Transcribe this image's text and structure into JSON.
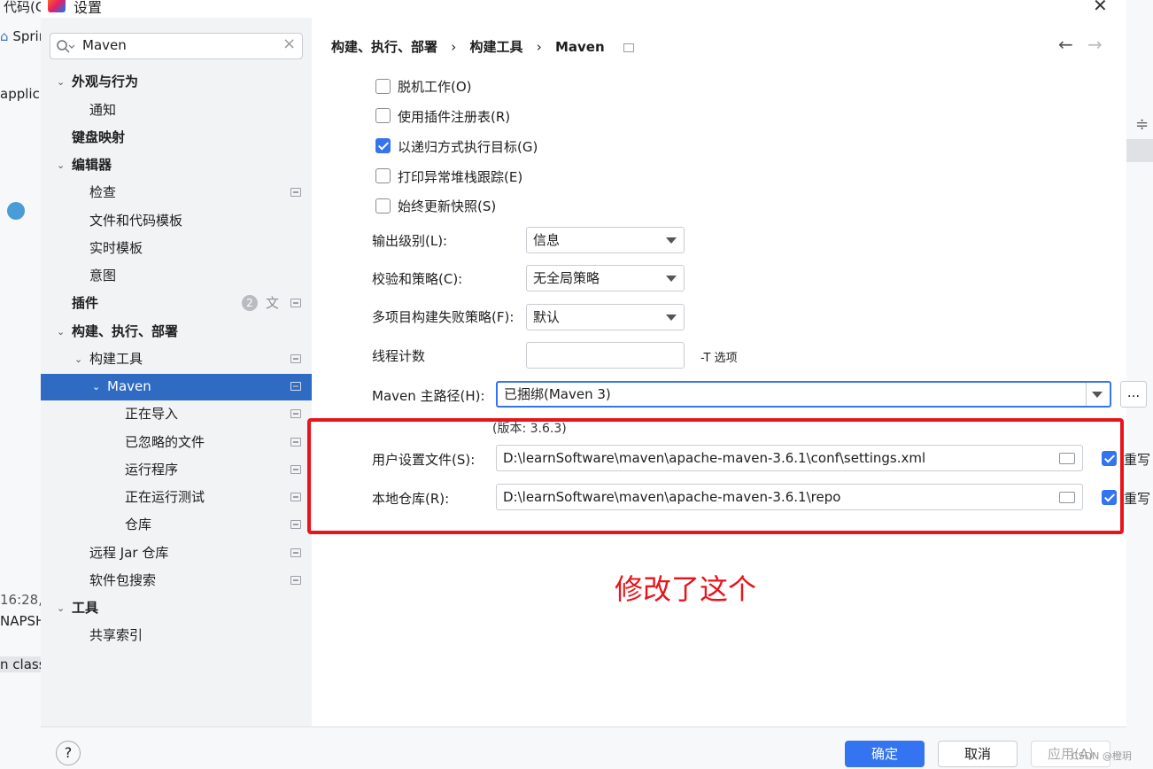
{
  "background": {
    "texts": [
      "代码(C",
      "Sprin",
      "applic",
      "16:28,",
      "NAPSH",
      "n class"
    ]
  },
  "dialog": {
    "title": "设置",
    "close_glyph": "✕",
    "search": {
      "value": "Maven",
      "clear_glyph": "×"
    },
    "tree": [
      {
        "label": "外观与行为"
      },
      {
        "label": "通知"
      },
      {
        "label": "键盘映射"
      },
      {
        "label": "编辑器"
      },
      {
        "label": "检查"
      },
      {
        "label": "文件和代码模板"
      },
      {
        "label": "实时模板"
      },
      {
        "label": "意图"
      },
      {
        "label": "插件",
        "badge": "2"
      },
      {
        "label": "构建、执行、部署"
      },
      {
        "label": "构建工具"
      },
      {
        "label": "Maven"
      },
      {
        "label": "正在导入"
      },
      {
        "label": "已忽略的文件"
      },
      {
        "label": "运行程序"
      },
      {
        "label": "正在运行测试"
      },
      {
        "label": "仓库"
      },
      {
        "label": "远程 Jar 仓库"
      },
      {
        "label": "软件包搜索"
      },
      {
        "label": "工具"
      },
      {
        "label": "共享索引"
      }
    ],
    "breadcrumb": [
      "构建、执行、部署",
      "构建工具",
      "Maven"
    ],
    "breadcrumb_sep": "›",
    "nav": {
      "back": "←",
      "forward": "→"
    },
    "checkboxes": [
      {
        "label": "脱机工作(O)",
        "checked": false
      },
      {
        "label": "使用插件注册表(R)",
        "checked": false
      },
      {
        "label": "以递归方式执行目标(G)",
        "checked": true
      },
      {
        "label": "打印异常堆栈跟踪(E)",
        "checked": false
      },
      {
        "label": "始终更新快照(S)",
        "checked": false
      }
    ],
    "output_level": {
      "label": "输出级别(L):",
      "value": "信息"
    },
    "checksum_policy": {
      "label": "校验和策略(C):",
      "value": "无全局策略"
    },
    "fail_policy": {
      "label": "多项目构建失败策略(F):",
      "value": "默认"
    },
    "thread_count": {
      "label": "线程计数",
      "value": "",
      "hint": "-T 选项"
    },
    "maven_home": {
      "label": "Maven 主路径(H):",
      "value": "已捆绑(Maven 3)",
      "browse": "...",
      "version": "(版本: 3.6.3)"
    },
    "user_settings": {
      "label": "用户设置文件(S):",
      "value": "D:\\learnSoftware\\maven\\apache-maven-3.6.1\\conf\\settings.xml",
      "override_label": "重写",
      "override": true
    },
    "local_repo": {
      "label": "本地仓库(R):",
      "value": "D:\\learnSoftware\\maven\\apache-maven-3.6.1\\repo",
      "override_label": "重写",
      "override": true
    },
    "annotation": "修改了这个",
    "footer": {
      "help": "?",
      "ok": "确定",
      "cancel": "取消",
      "apply": "应用(A)"
    },
    "watermark": "CSDN @橙玥"
  },
  "colors": {
    "selection": "#2f6bc3",
    "primary_button": "#3574f0",
    "annotation_red": "#e8141c"
  }
}
